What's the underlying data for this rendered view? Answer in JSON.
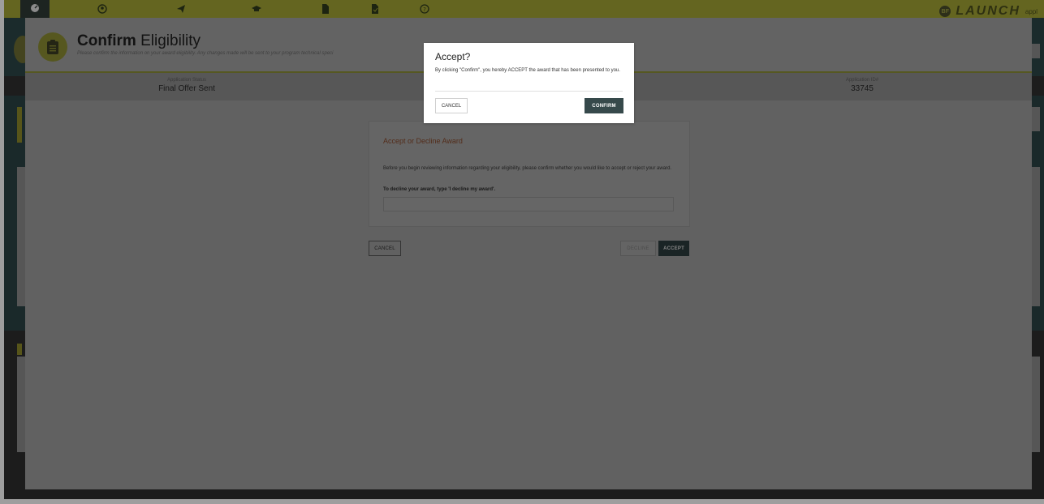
{
  "app": {
    "brand_logo_text": "LAUNCH",
    "brand_badge": "BF",
    "brand_sub": "appl"
  },
  "nav": {
    "icons": [
      "dashboard-icon",
      "user-icon",
      "send-icon",
      "graduation-cap-icon",
      "document-icon",
      "document-check-icon",
      "help-icon"
    ]
  },
  "header": {
    "title_bold": "Confirm",
    "title_rest": " Eligibility",
    "subtitle": "Please confirm the information on your award eligibility. Any changes made will be sent to your program technical speci"
  },
  "status": {
    "application_status_label": "Application Status",
    "application_status_value": "Final Offer Sent",
    "application_id_label": "Application ID#",
    "application_id_value": "33745"
  },
  "card": {
    "title": "Accept or Decline Award",
    "body": "Before you begin reviewing information regarding your eligibility, please confirm whether you would like to accept or reject your award.",
    "decline_instruction": "To decline your award, type 'I decline my award'.",
    "input_value": ""
  },
  "buttons": {
    "cancel": "CANCEL",
    "decline": "DECLINE",
    "accept": "ACCEPT"
  },
  "modal": {
    "title": "Accept?",
    "body": "By clicking \"Confirm\", you hereby ACCEPT the award that has been presented to you.",
    "cancel": "CANCEL",
    "confirm": "CONFIRM"
  },
  "colors": {
    "nav_bar": "#a2a434",
    "accent_dark_teal": "#36494b",
    "card_title": "#86482a",
    "overlay": "rgba(0,0,0,0.38)"
  }
}
